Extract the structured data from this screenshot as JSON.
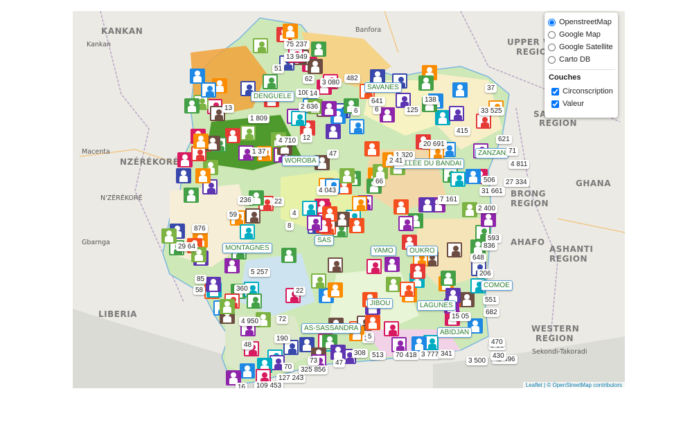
{
  "basemap_options": [
    {
      "label": "OpenstreetMap",
      "selected": true
    },
    {
      "label": "Google Map",
      "selected": false
    },
    {
      "label": "Google Satellite",
      "selected": false
    },
    {
      "label": "Carto DB",
      "selected": false
    }
  ],
  "layers_title": "Couches",
  "layers": [
    {
      "label": "Circonscription",
      "checked": true
    },
    {
      "label": "Valeur",
      "checked": true
    }
  ],
  "places": [
    "KANKAN",
    "Kankan",
    "Macenta",
    "NZÉRÉKORÉ",
    "N'ZÉRÉKORÉ",
    "Gbarnga",
    "LIBERIA",
    "Banfora",
    "UPPER W",
    "REGION",
    "SAVANES",
    "REGION",
    "GHANA",
    "BRONG",
    "AHAFO",
    "REGION",
    "ASHANTI",
    "REGION",
    "WESTERN",
    "REGION",
    "Sekondi-Takoradi"
  ],
  "regions": [
    "DENGUELE",
    "SAVANES",
    "WOROBA",
    "ZANZAN",
    "VALLEE DU BANDAMA",
    "MONTAGNES",
    "SASSANDRA",
    "YAMOUSSOUKRO",
    "COMOE",
    "GOH-DJIBOUA",
    "LAGUNES",
    "BAS-SASSANDRA",
    "ABIDJAN"
  ],
  "region_labels_visible": [
    "DENGUELE",
    "SAVANES",
    "WOROBA",
    "ZANZAN",
    "VALLEE DU BANDAI",
    "MONTAGNES",
    "SAS",
    "YAMO",
    "OUKRO",
    "COMOE",
    "JIBOU",
    "LAGUNES",
    "AS-SASSANDRA",
    "ABIDJAN"
  ],
  "values": [
    "75 237",
    "13 949",
    "3 080",
    "2 636",
    "6",
    "125",
    "138",
    "33 525",
    "415",
    "621",
    "71",
    "4 811",
    "27 334",
    "506",
    "31 661",
    "7 161",
    "2 400",
    "876",
    "593",
    "836",
    "648",
    "206",
    "682",
    "4 950",
    "1 37",
    "1 320",
    "4 043",
    "66",
    "2 41",
    "20 691",
    "85",
    "58",
    "360",
    "15 05",
    "190",
    "127 243",
    "109 453",
    "325 856",
    "70 418",
    "3 777",
    "341",
    "3 500",
    "42 496",
    "47",
    "513",
    "308",
    "73",
    "48",
    "16",
    "70",
    "72",
    "29 64",
    "59",
    "51",
    "62",
    "482",
    "100",
    "1 809",
    "4 710",
    "12",
    "22",
    "236",
    "13",
    "47",
    "5 257",
    "9 56",
    "430",
    "470",
    "551",
    "641",
    "6",
    "31",
    "5",
    "8",
    "4",
    "22",
    "37",
    "14"
  ],
  "attribution": "Leaflet | © OpenStreetMap contributors",
  "colors": {
    "region_fill": "#cfe8b8",
    "region_fill_dark": "#4e9a2c",
    "region_fill_orange": "#f1a23a",
    "border": "#7ab7e0",
    "label_text": "#2e7d32"
  }
}
